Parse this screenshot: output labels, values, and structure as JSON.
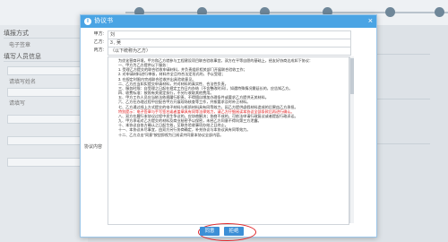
{
  "background": {
    "sidebar_items": [
      "填报方式",
      "电子签章",
      "填写人员信息",
      "请填写姓名",
      "请填写"
    ],
    "steps": 6
  },
  "dialog": {
    "title": "协议书",
    "close_icon": "close-icon",
    "fields": [
      {
        "label": "甲方:",
        "value": "刘"
      },
      {
        "label": "乙方:",
        "value": "3 , 吴"
      },
      {
        "label": "丙方:",
        "value": "（以下统称为乙方）"
      }
    ],
    "agreement_label": "协议内容",
    "agreement_paragraphs": [
      {
        "text": "为优化营商环境，甲方和乙方就参与工程建设项目联合验收事宜，双方在平等自愿的基础上，经友好协商达成如下协议：",
        "indent": true,
        "red": false
      },
      {
        "text": "一、甲方为乙方提供以下服务：",
        "indent": true,
        "red": false
      },
      {
        "text": "1. 受理乙方提交的联合验收申请材料，并负责组织相关部门开展联合验收工作；",
        "indent": true,
        "red": false
      },
      {
        "text": "2. 对申请材料进行审核，材料齐全且符合法定形式的，予以受理；",
        "indent": true,
        "red": false
      },
      {
        "text": "3. 在规定时限内完成联合验收并出具验收意见。",
        "indent": true,
        "red": false
      },
      {
        "text": "二、乙方应当如实提交申请材料，并对材料的真实性、合法性负责。",
        "indent": true,
        "red": false
      },
      {
        "text": "三、服务时限：自受理之日起在规定工作日内办结（不含整改时间），如遇特殊情况需延长的，应告知乙方。",
        "indent": true,
        "red": false
      },
      {
        "text": "四、收费标准：按照有关规定执行，不另行收取其他费用。",
        "indent": true,
        "red": false
      },
      {
        "text": "五、甲方工作人员应当依法依规履行职责，不得擅自增加办理条件或要求乙方提供无关材料。",
        "indent": true,
        "red": false
      },
      {
        "text": "六、乙方在办理过程中应配合甲方开展现场核查等工作，并按要求及时补正材料。",
        "indent": true,
        "red": false
      },
      {
        "text": "七、乙方通过线上方式提交的电子材料与纸质材料具有同等效力，因乙方提供虚假材料造成的后果由乙方承担。",
        "indent": true,
        "red": false
      },
      {
        "text": "特别提示：电子签章与手写签名或者盖章具有同等法律效力，请乙方仔细阅读本协议全部条款后再进行确认。",
        "indent": true,
        "red": true
      },
      {
        "text": "八、双方在履行本协议过程中发生争议的，应协商解决；协商不成的，可依法申请行政复议或者提起行政诉讼。",
        "indent": true,
        "red": false
      },
      {
        "text": "九、甲方承诺对乙方提交的材料及商业秘密予以保密，未经乙方同意不得向第三方泄露。",
        "indent": true,
        "red": false
      },
      {
        "text": "十、本协议自各方确认之日起生效，至联合验收事项办结之日终止。",
        "indent": true,
        "red": false
      },
      {
        "text": "十一、本协议未尽事宜，由双方另行协商确定，补充协议与本协议具有同等效力。",
        "indent": true,
        "red": false
      },
      {
        "text": "十二、乙方点击“同意”按钮即视为已阅读并同意本协议全部内容。",
        "indent": true,
        "red": false
      }
    ],
    "buttons": {
      "agree": "同意",
      "reject": "拒绝"
    }
  }
}
